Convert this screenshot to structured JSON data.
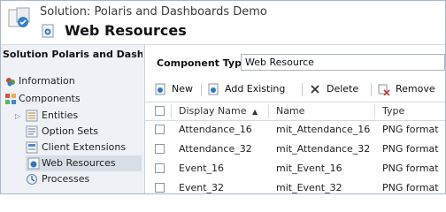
{
  "header": {
    "breadcrumb": "Solution: Polaris and Dashboards Demo",
    "title": "Web Resources"
  },
  "sidebar": {
    "title": "Solution Polaris and Dashbo...",
    "items": [
      {
        "label": "Information",
        "icon": "information-icon"
      },
      {
        "label": "Components",
        "icon": "components-icon"
      },
      {
        "label": "Entities",
        "icon": "entities-icon"
      },
      {
        "label": "Option Sets",
        "icon": "option-sets-icon"
      },
      {
        "label": "Client Extensions",
        "icon": "client-extensions-icon"
      },
      {
        "label": "Web Resources",
        "icon": "web-resources-icon",
        "selected": true
      },
      {
        "label": "Processes",
        "icon": "processes-icon"
      }
    ]
  },
  "filter": {
    "label": "Component Type",
    "value": "Web Resource"
  },
  "toolbar": {
    "new_label": "New",
    "add_existing_label": "Add Existing",
    "delete_label": "Delete",
    "remove_label": "Remove"
  },
  "grid": {
    "columns": [
      "Display Name",
      "Name",
      "Type"
    ],
    "sort_indicator": "▲",
    "rows": [
      {
        "display_name": "Attendance_16",
        "name": "mit_Attendance_16",
        "type": "PNG format"
      },
      {
        "display_name": "Attendance_32",
        "name": "mit_Attendance_32",
        "type": "PNG format"
      },
      {
        "display_name": "Event_16",
        "name": "mit_Event_16",
        "type": "PNG format"
      },
      {
        "display_name": "Event_32",
        "name": "mit_Event_32",
        "type": "PNG format"
      }
    ]
  },
  "colors": {
    "nav_background": "#eef2f7",
    "selected_item": "#d8dee6",
    "border": "#a7b8cc"
  }
}
